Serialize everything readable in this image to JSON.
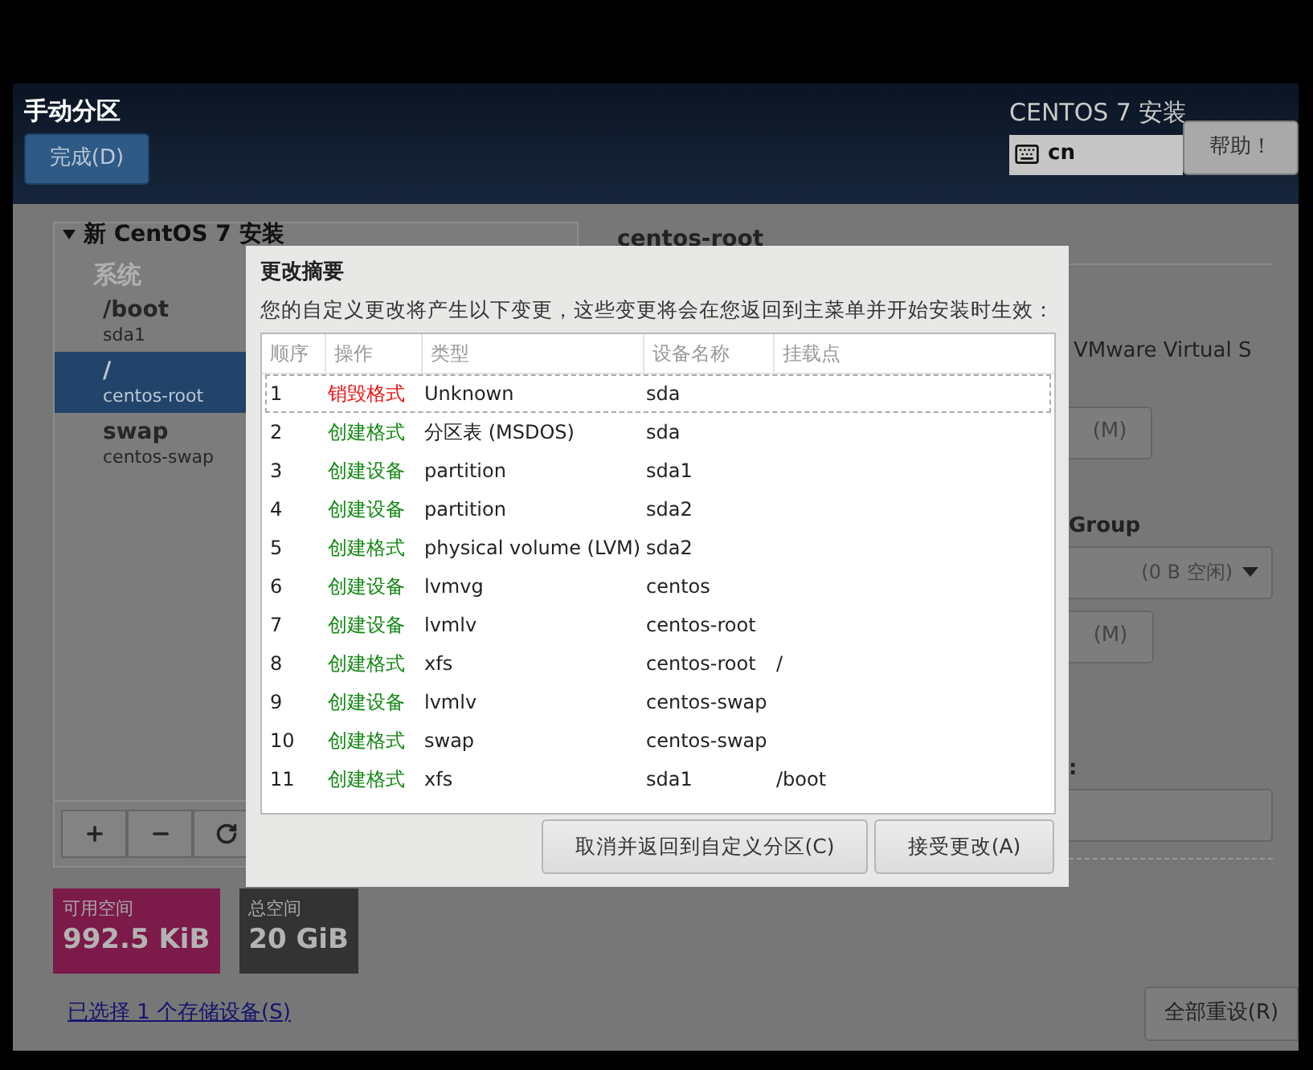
{
  "header": {
    "title": "手动分区",
    "done_button": "完成(D)",
    "product": "CENTOS 7 安装",
    "keyboard_layout": "cn",
    "help_button": "帮助！"
  },
  "partitions": {
    "root_label": "新 CentOS 7 安装",
    "expanded": true,
    "section": "系统",
    "items": [
      {
        "mount": "/boot",
        "device": "sda1",
        "selected": false
      },
      {
        "mount": "/",
        "device": "centos-root",
        "selected": true
      },
      {
        "mount": "swap",
        "device": "centos-swap",
        "selected": false
      }
    ]
  },
  "space": [
    {
      "label": "可用空间",
      "value": "992.5 KiB",
      "kind": "available"
    },
    {
      "label": "总空间",
      "value": "20 GiB",
      "kind": "total"
    }
  ],
  "storage_link": "已选择 1 个存储设备(S)",
  "reset_button": "全部重设(R)",
  "details": {
    "title": "centos-root",
    "device": "VMware Virtual S",
    "modify_button": "(M)",
    "group_label": "Group",
    "group_value": "(0 B 空闲)",
    "group_modify_button": "(M)",
    "field_label": ":"
  },
  "dialog": {
    "title": "更改摘要",
    "message": "您的自定义更改将产生以下变更，这些变更将会在您返回到主菜单并开始安装时生效：",
    "columns": [
      "顺序",
      "操作",
      "类型",
      "设备名称",
      "挂载点"
    ],
    "rows": [
      {
        "order": "1",
        "action": "销毁格式",
        "kind": "destroy",
        "type": "Unknown",
        "device": "sda",
        "focused": true
      },
      {
        "order": "2",
        "action": "创建格式",
        "kind": "create",
        "type": "分区表 (MSDOS)",
        "device": "sda",
        "focused": false
      },
      {
        "order": "3",
        "action": "创建设备",
        "kind": "create",
        "type": "partition",
        "device": "sda1",
        "focused": false
      },
      {
        "order": "4",
        "action": "创建设备",
        "kind": "create",
        "type": "partition",
        "device": "sda2",
        "focused": false
      },
      {
        "order": "5",
        "action": "创建格式",
        "kind": "create",
        "type": "physical volume (LVM)",
        "device": "sda2",
        "focused": false
      },
      {
        "order": "6",
        "action": "创建设备",
        "kind": "create",
        "type": "lvmvg",
        "device": "centos",
        "focused": false
      },
      {
        "order": "7",
        "action": "创建设备",
        "kind": "create",
        "type": "lvmlv",
        "device": "centos-root",
        "focused": false
      },
      {
        "order": "8",
        "action": "创建格式",
        "kind": "create",
        "type": "xfs",
        "device": "centos-root",
        "mount": "/",
        "focused": false
      },
      {
        "order": "9",
        "action": "创建设备",
        "kind": "create",
        "type": "lvmlv",
        "device": "centos-swap",
        "focused": false
      },
      {
        "order": "10",
        "action": "创建格式",
        "kind": "create",
        "type": "swap",
        "device": "centos-swap",
        "focused": false
      },
      {
        "order": "11",
        "action": "创建格式",
        "kind": "create",
        "type": "xfs",
        "device": "sda1",
        "mount": "/boot",
        "focused": false
      }
    ],
    "cancel_button": "取消并返回到自定义分区(C)",
    "accept_button": "接受更改(A)"
  }
}
